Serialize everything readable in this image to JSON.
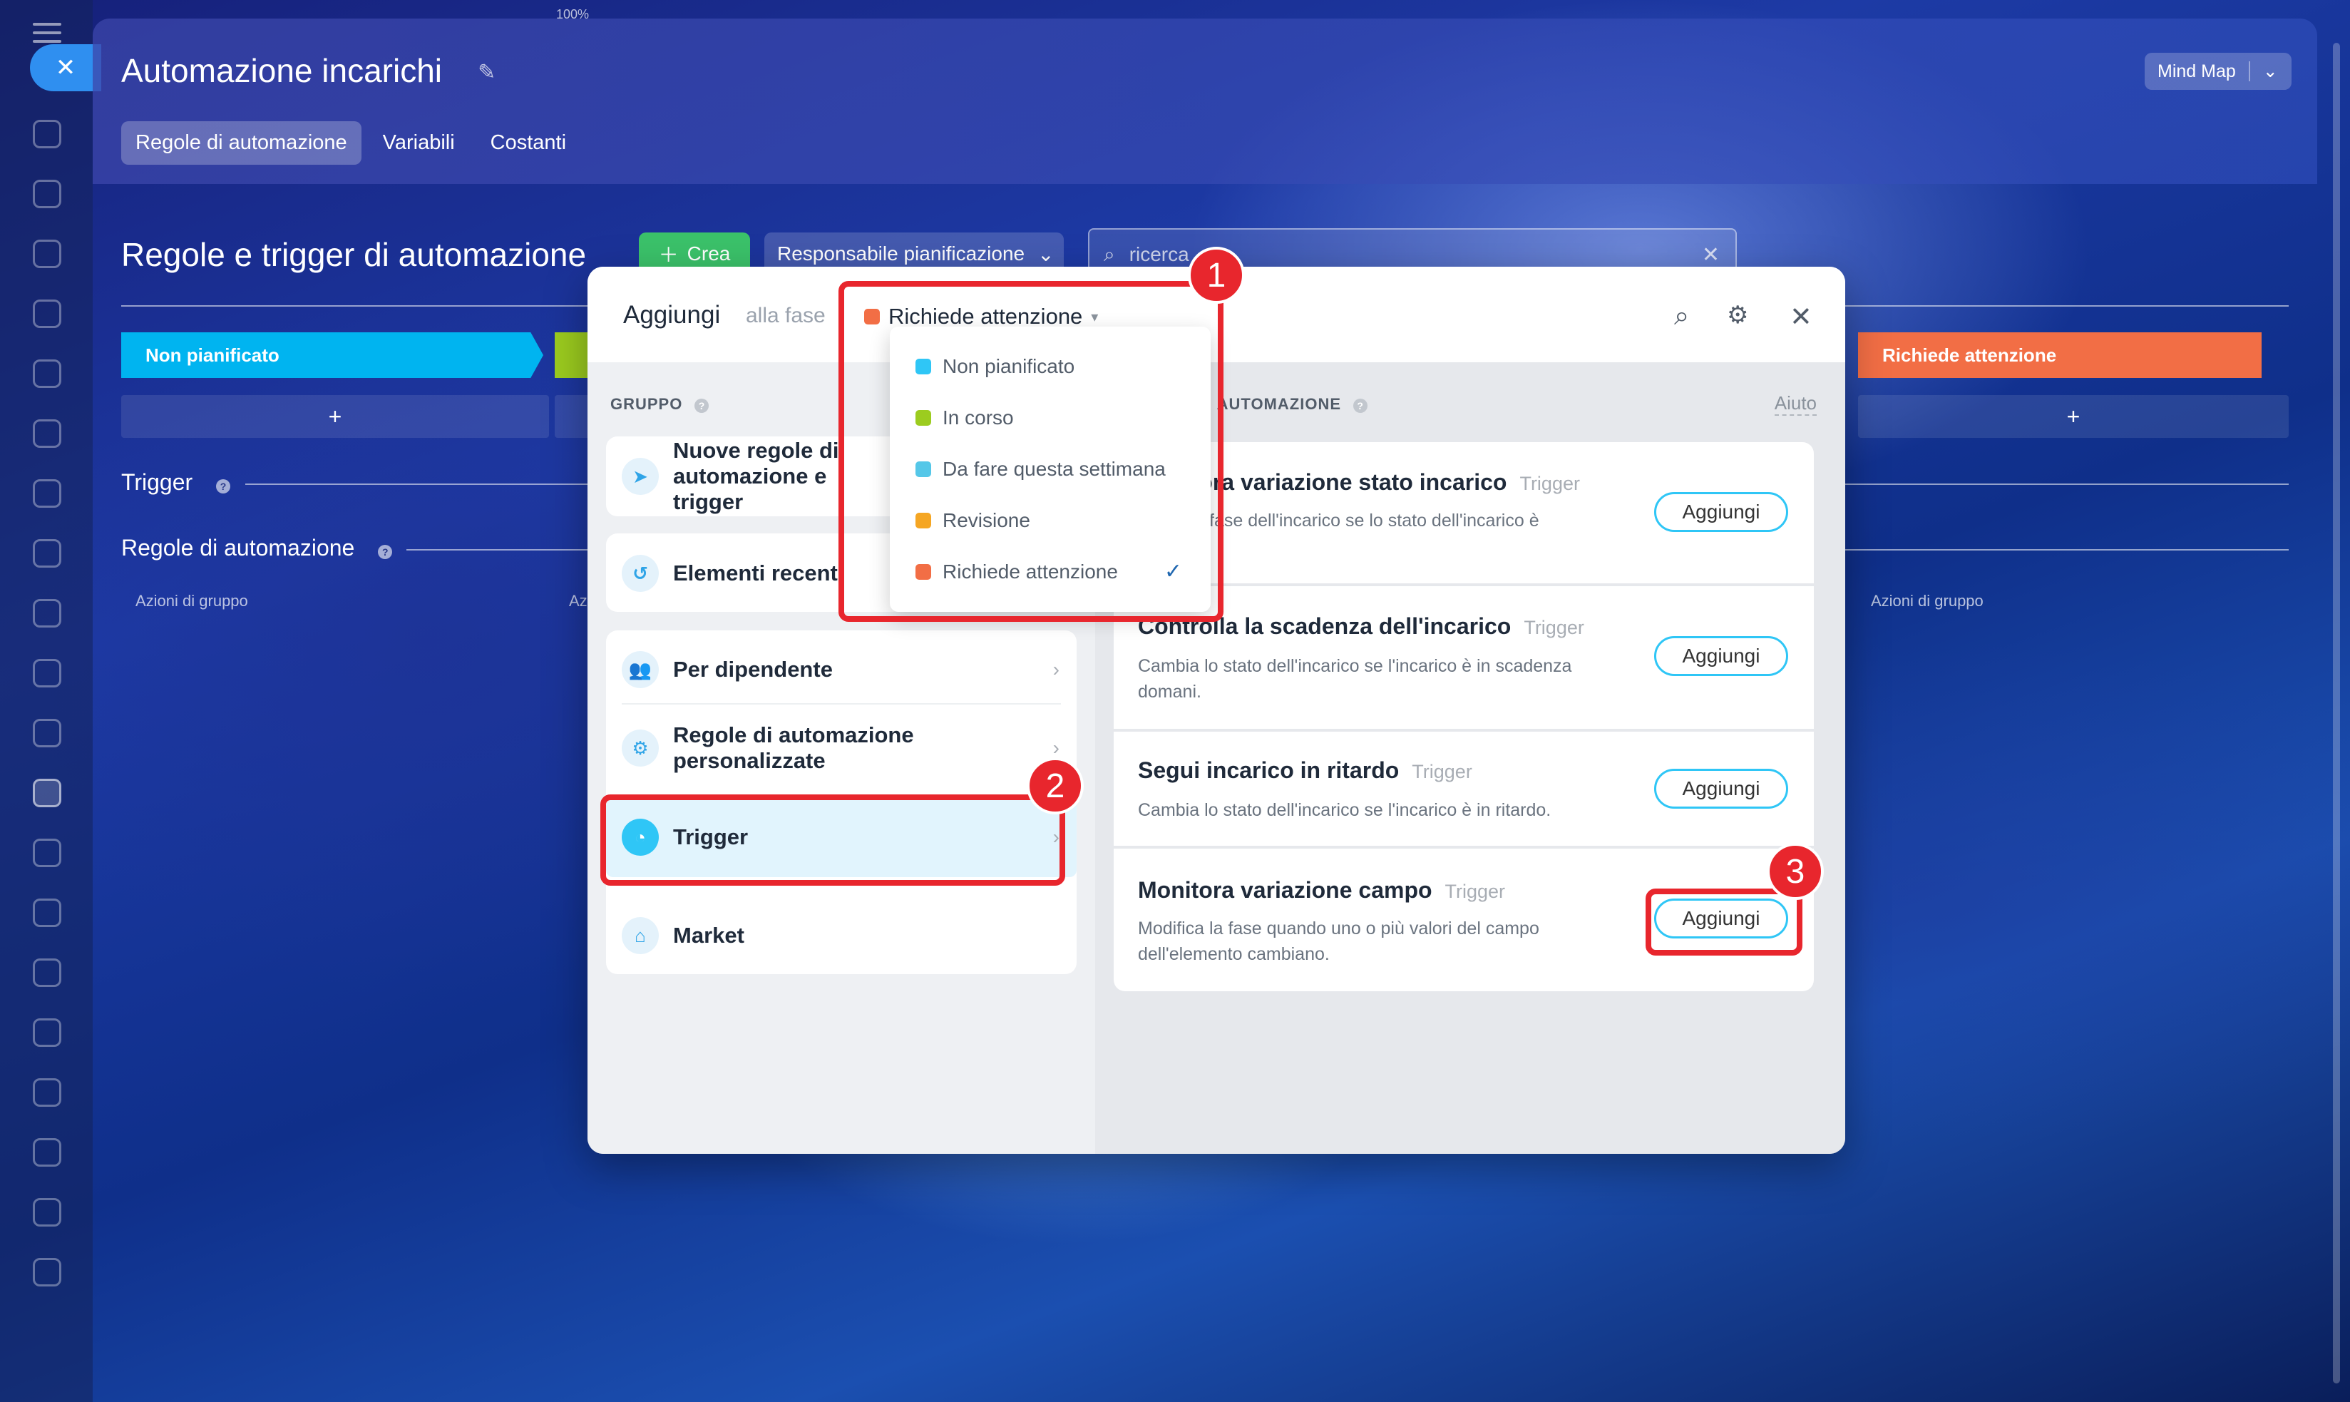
{
  "app": {
    "title": "Automazione incarichi",
    "mindmap_label": "Mind Map",
    "tabs": [
      {
        "label": "Regole di automazione"
      },
      {
        "label": "Variabili"
      },
      {
        "label": "Costanti"
      }
    ],
    "zoom": "100%"
  },
  "toolbar": {
    "section_title": "Regole e trigger di automazione",
    "create_label": "Crea",
    "responsible_label": "Responsabile pianificazione",
    "search_value": "ricerca"
  },
  "board": {
    "stages": [
      {
        "label": "Non pianificato",
        "color": "#00b4f0"
      },
      {
        "label": "In corso",
        "color": "#9ccc1f"
      },
      {
        "label": "Richiede attenzione",
        "color": "#f26e45"
      }
    ],
    "trigger_label": "Trigger",
    "rules_label": "Regole di automazione",
    "group_actions": "Azioni di gruppo",
    "group_actions_short": "Az"
  },
  "modal": {
    "title": "Aggiungi",
    "subtitle": "alla fase",
    "selected_stage": "Richiede attenzione",
    "group_label": "GRUPPO",
    "triggers_label": "TRIGGER DI AUTOMAZIONE",
    "help_label": "Aiuto",
    "groups": [
      {
        "label": "Nuove regole di automazione e trigger"
      },
      {
        "label": "Elementi recenti"
      },
      {
        "label": "Per dipendente"
      },
      {
        "label": "Regole di automazione personalizzate"
      },
      {
        "label": "Trigger"
      },
      {
        "label": "Market"
      }
    ],
    "stage_options": [
      {
        "label": "Non pianificato",
        "color": "#2fc6f6"
      },
      {
        "label": "In corso",
        "color": "#9ccc1f"
      },
      {
        "label": "Da fare questa settimana",
        "color": "#55c7e8"
      },
      {
        "label": "Revisione",
        "color": "#f5a623"
      },
      {
        "label": "Richiede attenzione",
        "color": "#f26e45"
      }
    ],
    "triggers": [
      {
        "title": "Monitora variazione stato incarico",
        "tag": "Trigger",
        "desc": "Modifica fase dell'incarico se lo stato dell'incarico è",
        "button": "Aggiungi"
      },
      {
        "title": "Controlla la scadenza dell'incarico",
        "tag": "Trigger",
        "desc": "Cambia lo stato dell'incarico se l'incarico è in scadenza domani.",
        "button": "Aggiungi"
      },
      {
        "title": "Segui incarico in ritardo",
        "tag": "Trigger",
        "desc": "Cambia lo stato dell'incarico se l'incarico è in ritardo.",
        "button": "Aggiungi"
      },
      {
        "title": "Monitora variazione campo",
        "tag": "Trigger",
        "desc": "Modifica la fase quando uno o più valori del campo dell'elemento cambiano.",
        "button": "Aggiungi"
      }
    ]
  },
  "callouts": [
    "1",
    "2",
    "3"
  ]
}
